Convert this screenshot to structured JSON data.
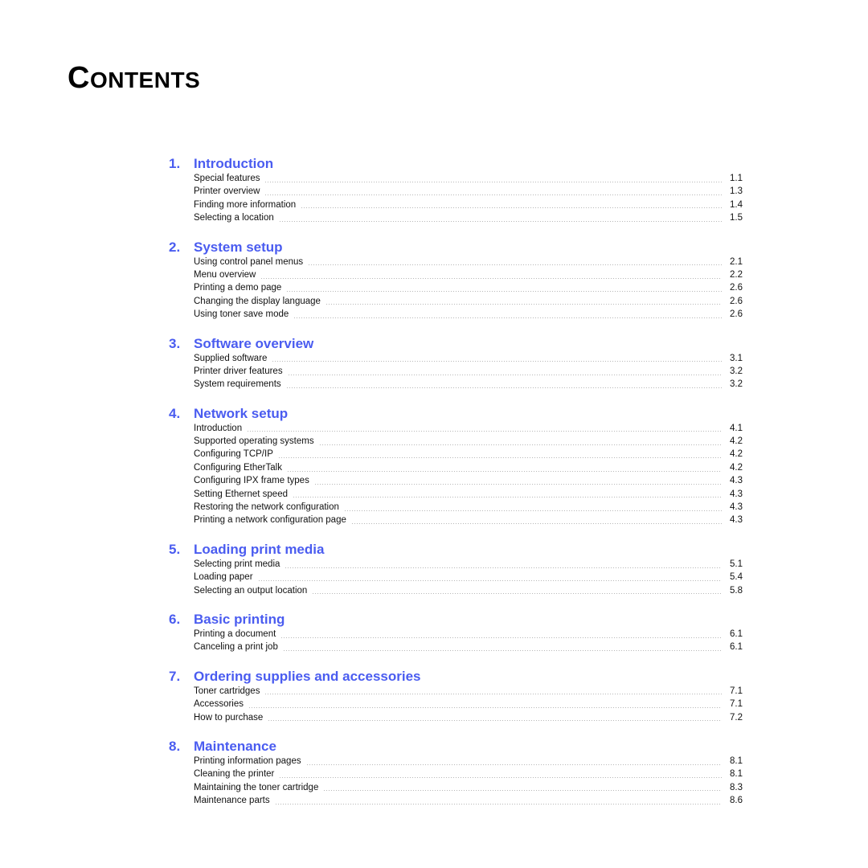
{
  "document": {
    "title_initial": "C",
    "title_rest": "ONTENTS",
    "heading_color": "#4a5cf0"
  },
  "toc": {
    "sections": [
      {
        "number": "1.",
        "title": "Introduction",
        "entries": [
          {
            "title": "Special features",
            "page": "1.1"
          },
          {
            "title": "Printer overview",
            "page": "1.3"
          },
          {
            "title": "Finding more information",
            "page": "1.4"
          },
          {
            "title": "Selecting a location",
            "page": "1.5"
          }
        ]
      },
      {
        "number": "2.",
        "title": "System setup",
        "entries": [
          {
            "title": "Using control panel menus",
            "page": "2.1"
          },
          {
            "title": "Menu overview",
            "page": "2.2"
          },
          {
            "title": "Printing a demo page",
            "page": "2.6"
          },
          {
            "title": "Changing the display language",
            "page": "2.6"
          },
          {
            "title": "Using toner save mode",
            "page": "2.6"
          }
        ]
      },
      {
        "number": "3.",
        "title": "Software overview",
        "entries": [
          {
            "title": "Supplied software",
            "page": "3.1"
          },
          {
            "title": "Printer driver features",
            "page": "3.2"
          },
          {
            "title": "System requirements",
            "page": "3.2"
          }
        ]
      },
      {
        "number": "4.",
        "title": "Network setup",
        "entries": [
          {
            "title": "Introduction",
            "page": "4.1"
          },
          {
            "title": "Supported operating systems",
            "page": "4.2"
          },
          {
            "title": "Configuring TCP/IP",
            "page": "4.2"
          },
          {
            "title": "Configuring EtherTalk",
            "page": "4.2"
          },
          {
            "title": "Configuring IPX frame types",
            "page": "4.3"
          },
          {
            "title": "Setting Ethernet speed",
            "page": "4.3"
          },
          {
            "title": "Restoring the network configuration",
            "page": "4.3"
          },
          {
            "title": "Printing a network configuration page",
            "page": "4.3"
          }
        ]
      },
      {
        "number": "5.",
        "title": "Loading print media",
        "entries": [
          {
            "title": "Selecting print media",
            "page": "5.1"
          },
          {
            "title": "Loading paper",
            "page": "5.4"
          },
          {
            "title": "Selecting an output location",
            "page": "5.8"
          }
        ]
      },
      {
        "number": "6.",
        "title": "Basic printing",
        "entries": [
          {
            "title": "Printing a document",
            "page": "6.1"
          },
          {
            "title": "Canceling a print job",
            "page": "6.1"
          }
        ]
      },
      {
        "number": "7.",
        "title": "Ordering supplies and accessories",
        "entries": [
          {
            "title": "Toner cartridges",
            "page": "7.1"
          },
          {
            "title": "Accessories",
            "page": "7.1"
          },
          {
            "title": "How to purchase",
            "page": "7.2"
          }
        ]
      },
      {
        "number": "8.",
        "title": "Maintenance",
        "entries": [
          {
            "title": "Printing information pages",
            "page": "8.1"
          },
          {
            "title": "Cleaning the printer",
            "page": "8.1"
          },
          {
            "title": "Maintaining the toner cartridge",
            "page": "8.3"
          },
          {
            "title": "Maintenance parts",
            "page": "8.6"
          }
        ]
      }
    ]
  }
}
